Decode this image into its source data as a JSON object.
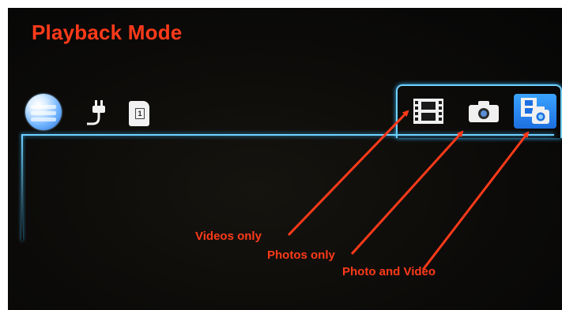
{
  "title": "Playback Mode",
  "status_icons": [
    "globe-icon",
    "power-plug-icon",
    "memory-card-icon"
  ],
  "memory_card_number": "1",
  "tabs": [
    {
      "icon": "film-strip-icon",
      "label": "Videos only",
      "selected": false
    },
    {
      "icon": "camera-icon",
      "label": "Photos only",
      "selected": false
    },
    {
      "icon": "photo-and-video-icon",
      "label": "Photo and Video",
      "selected": true
    }
  ],
  "colors": {
    "annotation": "#ff3a1a",
    "panel_outline": "#6fd2ff",
    "selected_tab": "#2b8cf5",
    "background": "#0c0b09"
  }
}
